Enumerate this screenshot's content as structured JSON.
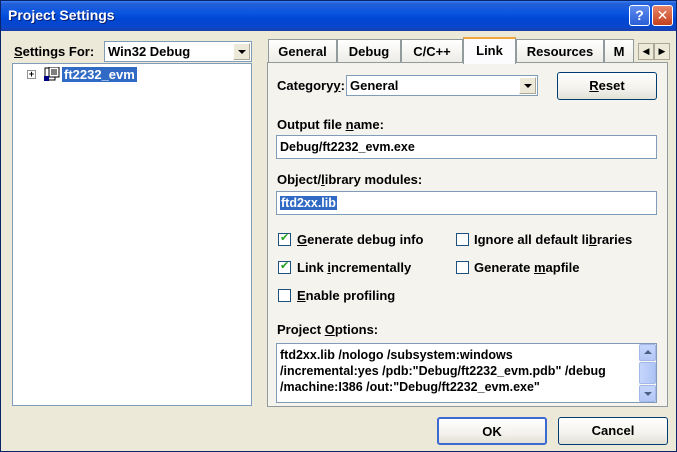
{
  "window": {
    "title": "Project Settings"
  },
  "settings_for": {
    "label_pre": "",
    "label_ul": "S",
    "label_post": "ettings For:",
    "value": "Win32 Debug"
  },
  "tree": {
    "expander": "+",
    "node_label": "ft2232_evm"
  },
  "tabs": [
    "General",
    "Debug",
    "C/C++",
    "Link",
    "Resources",
    "M"
  ],
  "active_tab": "Link",
  "category": {
    "label_pre": "Category",
    "label_ul": "y",
    "label_post": ":",
    "value": "General"
  },
  "reset_button": {
    "pre": "",
    "ul": "R",
    "post": "eset"
  },
  "output_file": {
    "label_pre": "Output file ",
    "label_ul": "n",
    "label_post": "ame:",
    "value": "Debug/ft2232_evm.exe"
  },
  "object_modules": {
    "label_pre": "Object/",
    "label_ul": "l",
    "label_post": "ibrary modules:",
    "value": "ftd2xx.lib"
  },
  "checkboxes": [
    {
      "pre": "",
      "ul": "G",
      "post": "enerate debug info",
      "checked": true
    },
    {
      "pre": "Ignore all default li",
      "ul": "b",
      "post": "raries",
      "checked": false
    },
    {
      "pre": "Link ",
      "ul": "i",
      "post": "ncrementally",
      "checked": true
    },
    {
      "pre": "Generate ",
      "ul": "m",
      "post": "apfile",
      "checked": false
    },
    {
      "pre": "",
      "ul": "E",
      "post": "nable profiling",
      "checked": false
    }
  ],
  "project_options": {
    "label_pre": "Project ",
    "label_ul": "O",
    "label_post": "ptions:",
    "lines": [
      "ftd2xx.lib /nologo /subsystem:windows",
      "/incremental:yes /pdb:\"Debug/ft2232_evm.pdb\" /debug",
      "/machine:I386 /out:\"Debug/ft2232_evm.exe\""
    ]
  },
  "buttons": {
    "ok": "OK",
    "cancel": "Cancel"
  },
  "title_buttons": {
    "help": "?",
    "close": "✕"
  }
}
